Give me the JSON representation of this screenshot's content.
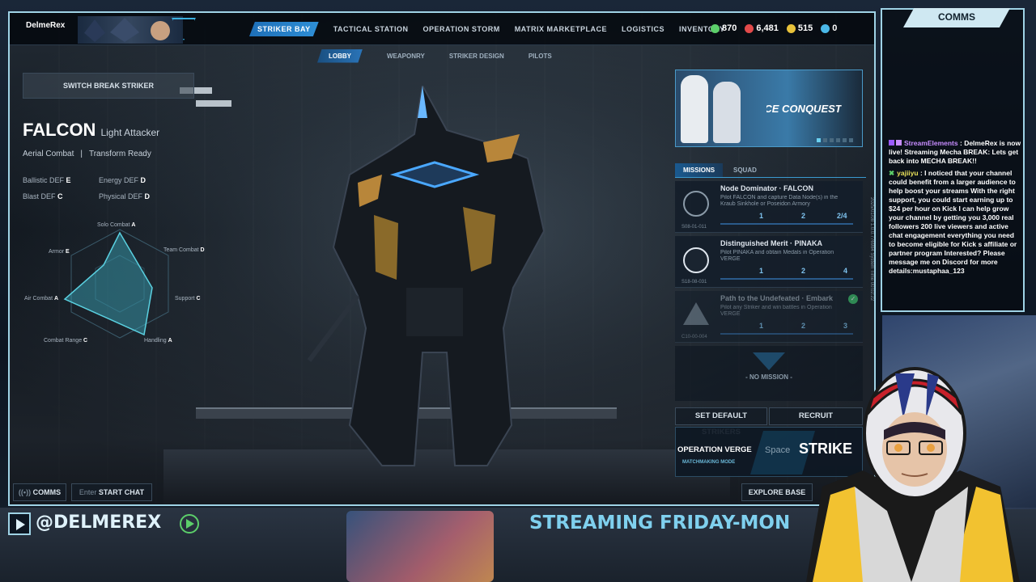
{
  "player": {
    "name": "DelmeRex"
  },
  "nav": {
    "tabs": [
      {
        "label": "STRIKER BAY"
      },
      {
        "label": "TACTICAL STATION"
      },
      {
        "label": "OPERATION STORM"
      },
      {
        "label": "MATRIX MARKETPLACE"
      },
      {
        "label": "LOGISTICS"
      },
      {
        "label": "INVENTORY"
      }
    ]
  },
  "subnav": {
    "tabs": [
      {
        "label": "LOBBY"
      },
      {
        "label": "WEAPONRY"
      },
      {
        "label": "STRIKER DESIGN"
      },
      {
        "label": "PILOTS"
      }
    ]
  },
  "resources": [
    {
      "value": "870",
      "color": "#5ccf6a"
    },
    {
      "value": "6,481",
      "color": "#e24a4a"
    },
    {
      "value": "515",
      "color": "#e8c23a"
    },
    {
      "value": "0",
      "color": "#4ab8e8"
    }
  ],
  "switch_label": "SWITCH BREAK STRIKER",
  "striker": {
    "name": "FALCON",
    "role": "Light Attacker",
    "trait1": "Aerial Combat",
    "trait2": "Transform Ready",
    "ballistic": "Ballistic DEF",
    "ballistic_v": "E",
    "energy": "Energy DEF",
    "energy_v": "D",
    "blast": "Blast DEF",
    "blast_v": "C",
    "physical": "Physical DEF",
    "physical_v": "D"
  },
  "radar": {
    "solo": "Solo Combat",
    "solo_v": "A",
    "team": "Team Combat",
    "team_v": "D",
    "support": "Support",
    "support_v": "C",
    "handling": "Handling",
    "handling_v": "A",
    "range": "Combat Range",
    "range_v": "C",
    "air": "Air Combat",
    "air_v": "A",
    "armor": "Armor",
    "armor_v": "E"
  },
  "banner": {
    "text": "ACE CONQUEST"
  },
  "mission_tabs": {
    "missions": "MISSIONS",
    "squad": "SQUAD"
  },
  "missions": [
    {
      "title": "Node Dominator · FALCON",
      "desc": "Pilot FALCON and capture Data Node(s) in the Kraub Sinkhole or Poseidon Armory",
      "code": "S08-01-011",
      "p1": "1",
      "p2": "2",
      "p3": "2/4"
    },
    {
      "title": "Distinguished Merit · PINAKA",
      "desc": "Pilot PINAKA and obtain Medals in Operation VERGE",
      "code": "S18-08-031",
      "p1": "1",
      "p2": "2",
      "p3": "4"
    },
    {
      "title": "Path to the Undefeated · Embark",
      "desc": "Pilot any Striker and win battles in Operation VERGE",
      "code": "C10-00-004",
      "p1": "1",
      "p2": "2",
      "p3": "3"
    }
  ],
  "no_mission": "NO MISSION",
  "set_default": "SET DEFAULT STRIKERS",
  "recruit": "RECRUIT",
  "operation": {
    "name": "OPERATION VERGE",
    "mode": "MATCHMAKING MODE",
    "key": "Space",
    "strike": "STRIKE"
  },
  "comms_btn": "COMMS",
  "chat_btn": {
    "key": "Enter",
    "label": "START CHAT"
  },
  "explore": "EXPLORE BASE",
  "side_info": {
    "date": "2025/01/08",
    "version": "1.0.0.776984",
    "system": "System Time",
    "time": "00:02:22"
  },
  "chat": {
    "title": "COMMS",
    "messages": [
      {
        "user": "StreamElements",
        "text": "DelmeRex is now live! Streaming Mecha BREAK: Lets get back into MECHA BREAK!!",
        "color": "#c78cff"
      },
      {
        "user": "yajiiyu",
        "text": "I noticed that your channel could benefit from a larger audience to help boost your streams With the right support, you could start earning up to $24 per hour on Kick I can help grow your channel by getting you 3,000 real followers 200 live viewers and active chat engagement everything you need to become eligible for Kick s affiliate or partner program Interested? Please message me on Discord for more details:mustaphaa_123",
        "color": "#e8e05a"
      }
    ]
  },
  "footer": {
    "handle": "@DELMEREX",
    "schedule": "STREAMING FRIDAY-MON"
  }
}
